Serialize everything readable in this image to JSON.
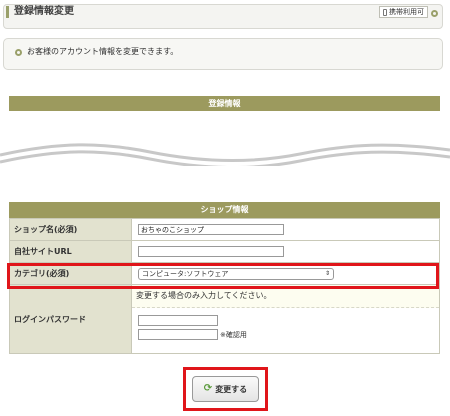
{
  "header": {
    "title": "登録情報変更",
    "mobile_badge": "携帯利用可"
  },
  "info": {
    "message": "お客様のアカウント情報を変更できます。"
  },
  "registration": {
    "title": "登録情報"
  },
  "shop": {
    "title": "ショップ情報",
    "rows": [
      {
        "label": "ショップ名(必須)",
        "value": "おちゃのこショップ"
      },
      {
        "label": "自社サイトURL",
        "value": ""
      },
      {
        "label": "カテゴリ(必須)",
        "selected": "コンピュータ:ソフトウェア"
      },
      {
        "label": "ログインパスワード",
        "note": "変更する場合のみ入力してください。",
        "confirm_label": "※確認用"
      }
    ]
  },
  "submit": {
    "label": "変更する"
  },
  "colors": {
    "section_bar": "#9c9a5e",
    "label_bg": "#e2e2cf",
    "highlight": "#e0151a"
  }
}
